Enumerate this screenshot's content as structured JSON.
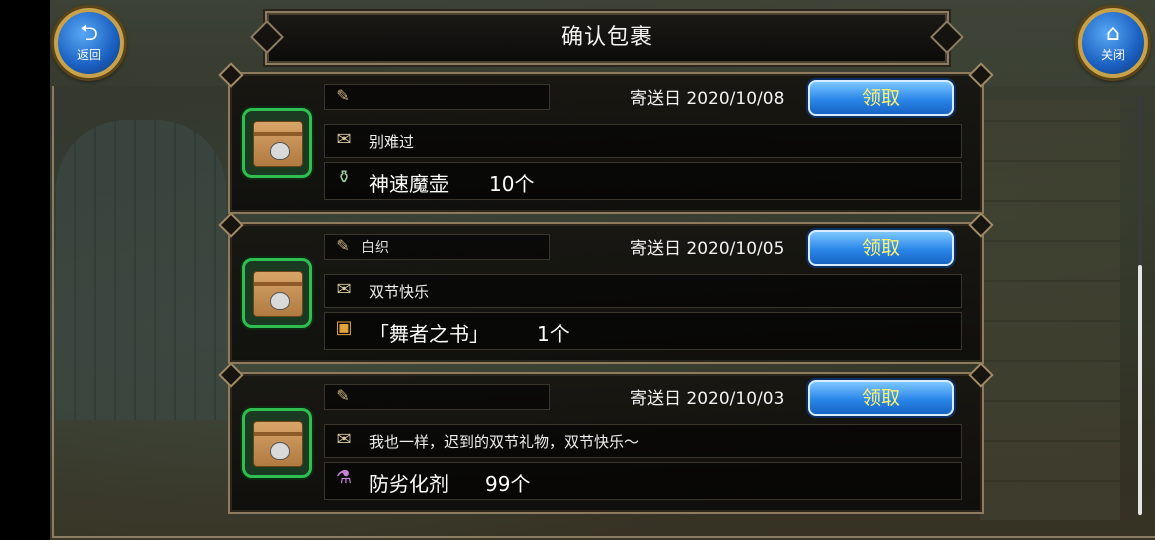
{
  "header": {
    "title": "确认包裹"
  },
  "buttons": {
    "back_label": "返回",
    "close_label": "关闭"
  },
  "parcels": [
    {
      "sender": "",
      "date_label": "寄送日",
      "date": "2020/10/08",
      "claim_label": "领取",
      "message": "别难过",
      "item_name": "神速魔壶",
      "item_qty": "10个",
      "item_icon": "potion-bottle-icon"
    },
    {
      "sender": "白织",
      "date_label": "寄送日",
      "date": "2020/10/05",
      "claim_label": "领取",
      "message": "双节快乐",
      "item_name": "「舞者之书」",
      "item_qty": "1个",
      "item_icon": "book-icon"
    },
    {
      "sender": "",
      "date_label": "寄送日",
      "date": "2020/10/03",
      "claim_label": "领取",
      "message": "我也一样，迟到的双节礼物，双节快乐～",
      "item_name": "防劣化剂",
      "item_qty": "99个",
      "item_icon": "flask-icon"
    }
  ],
  "colors": {
    "accent_gold": "#c8a24a",
    "claim_text": "#fff36a",
    "claim_button": "#2a86e9",
    "package_border": "#2fbe52"
  }
}
